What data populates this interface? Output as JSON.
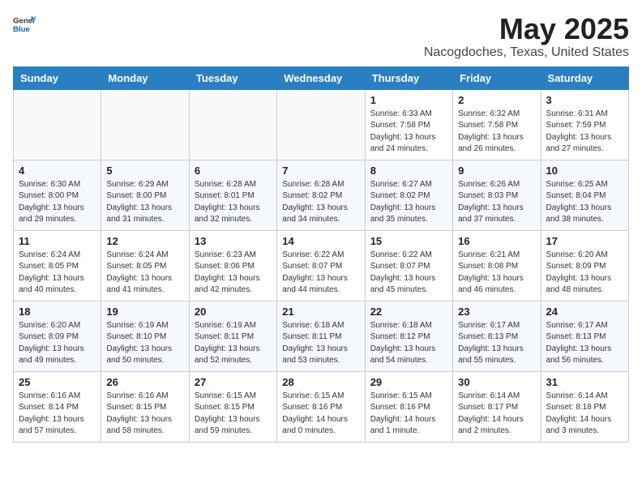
{
  "logo": {
    "general": "General",
    "blue": "Blue"
  },
  "header": {
    "title": "May 2025",
    "subtitle": "Nacogdoches, Texas, United States"
  },
  "weekdays": [
    "Sunday",
    "Monday",
    "Tuesday",
    "Wednesday",
    "Thursday",
    "Friday",
    "Saturday"
  ],
  "weeks": [
    [
      {
        "day": "",
        "info": ""
      },
      {
        "day": "",
        "info": ""
      },
      {
        "day": "",
        "info": ""
      },
      {
        "day": "",
        "info": ""
      },
      {
        "day": "1",
        "info": "Sunrise: 6:33 AM\nSunset: 7:58 PM\nDaylight: 13 hours\nand 24 minutes."
      },
      {
        "day": "2",
        "info": "Sunrise: 6:32 AM\nSunset: 7:58 PM\nDaylight: 13 hours\nand 26 minutes."
      },
      {
        "day": "3",
        "info": "Sunrise: 6:31 AM\nSunset: 7:59 PM\nDaylight: 13 hours\nand 27 minutes."
      }
    ],
    [
      {
        "day": "4",
        "info": "Sunrise: 6:30 AM\nSunset: 8:00 PM\nDaylight: 13 hours\nand 29 minutes."
      },
      {
        "day": "5",
        "info": "Sunrise: 6:29 AM\nSunset: 8:00 PM\nDaylight: 13 hours\nand 31 minutes."
      },
      {
        "day": "6",
        "info": "Sunrise: 6:28 AM\nSunset: 8:01 PM\nDaylight: 13 hours\nand 32 minutes."
      },
      {
        "day": "7",
        "info": "Sunrise: 6:28 AM\nSunset: 8:02 PM\nDaylight: 13 hours\nand 34 minutes."
      },
      {
        "day": "8",
        "info": "Sunrise: 6:27 AM\nSunset: 8:02 PM\nDaylight: 13 hours\nand 35 minutes."
      },
      {
        "day": "9",
        "info": "Sunrise: 6:26 AM\nSunset: 8:03 PM\nDaylight: 13 hours\nand 37 minutes."
      },
      {
        "day": "10",
        "info": "Sunrise: 6:25 AM\nSunset: 8:04 PM\nDaylight: 13 hours\nand 38 minutes."
      }
    ],
    [
      {
        "day": "11",
        "info": "Sunrise: 6:24 AM\nSunset: 8:05 PM\nDaylight: 13 hours\nand 40 minutes."
      },
      {
        "day": "12",
        "info": "Sunrise: 6:24 AM\nSunset: 8:05 PM\nDaylight: 13 hours\nand 41 minutes."
      },
      {
        "day": "13",
        "info": "Sunrise: 6:23 AM\nSunset: 8:06 PM\nDaylight: 13 hours\nand 42 minutes."
      },
      {
        "day": "14",
        "info": "Sunrise: 6:22 AM\nSunset: 8:07 PM\nDaylight: 13 hours\nand 44 minutes."
      },
      {
        "day": "15",
        "info": "Sunrise: 6:22 AM\nSunset: 8:07 PM\nDaylight: 13 hours\nand 45 minutes."
      },
      {
        "day": "16",
        "info": "Sunrise: 6:21 AM\nSunset: 8:08 PM\nDaylight: 13 hours\nand 46 minutes."
      },
      {
        "day": "17",
        "info": "Sunrise: 6:20 AM\nSunset: 8:09 PM\nDaylight: 13 hours\nand 48 minutes."
      }
    ],
    [
      {
        "day": "18",
        "info": "Sunrise: 6:20 AM\nSunset: 8:09 PM\nDaylight: 13 hours\nand 49 minutes."
      },
      {
        "day": "19",
        "info": "Sunrise: 6:19 AM\nSunset: 8:10 PM\nDaylight: 13 hours\nand 50 minutes."
      },
      {
        "day": "20",
        "info": "Sunrise: 6:19 AM\nSunset: 8:11 PM\nDaylight: 13 hours\nand 52 minutes."
      },
      {
        "day": "21",
        "info": "Sunrise: 6:18 AM\nSunset: 8:11 PM\nDaylight: 13 hours\nand 53 minutes."
      },
      {
        "day": "22",
        "info": "Sunrise: 6:18 AM\nSunset: 8:12 PM\nDaylight: 13 hours\nand 54 minutes."
      },
      {
        "day": "23",
        "info": "Sunrise: 6:17 AM\nSunset: 8:13 PM\nDaylight: 13 hours\nand 55 minutes."
      },
      {
        "day": "24",
        "info": "Sunrise: 6:17 AM\nSunset: 8:13 PM\nDaylight: 13 hours\nand 56 minutes."
      }
    ],
    [
      {
        "day": "25",
        "info": "Sunrise: 6:16 AM\nSunset: 8:14 PM\nDaylight: 13 hours\nand 57 minutes."
      },
      {
        "day": "26",
        "info": "Sunrise: 6:16 AM\nSunset: 8:15 PM\nDaylight: 13 hours\nand 58 minutes."
      },
      {
        "day": "27",
        "info": "Sunrise: 6:15 AM\nSunset: 8:15 PM\nDaylight: 13 hours\nand 59 minutes."
      },
      {
        "day": "28",
        "info": "Sunrise: 6:15 AM\nSunset: 8:16 PM\nDaylight: 14 hours\nand 0 minutes."
      },
      {
        "day": "29",
        "info": "Sunrise: 6:15 AM\nSunset: 8:16 PM\nDaylight: 14 hours\nand 1 minute."
      },
      {
        "day": "30",
        "info": "Sunrise: 6:14 AM\nSunset: 8:17 PM\nDaylight: 14 hours\nand 2 minutes."
      },
      {
        "day": "31",
        "info": "Sunrise: 6:14 AM\nSunset: 8:18 PM\nDaylight: 14 hours\nand 3 minutes."
      }
    ]
  ]
}
